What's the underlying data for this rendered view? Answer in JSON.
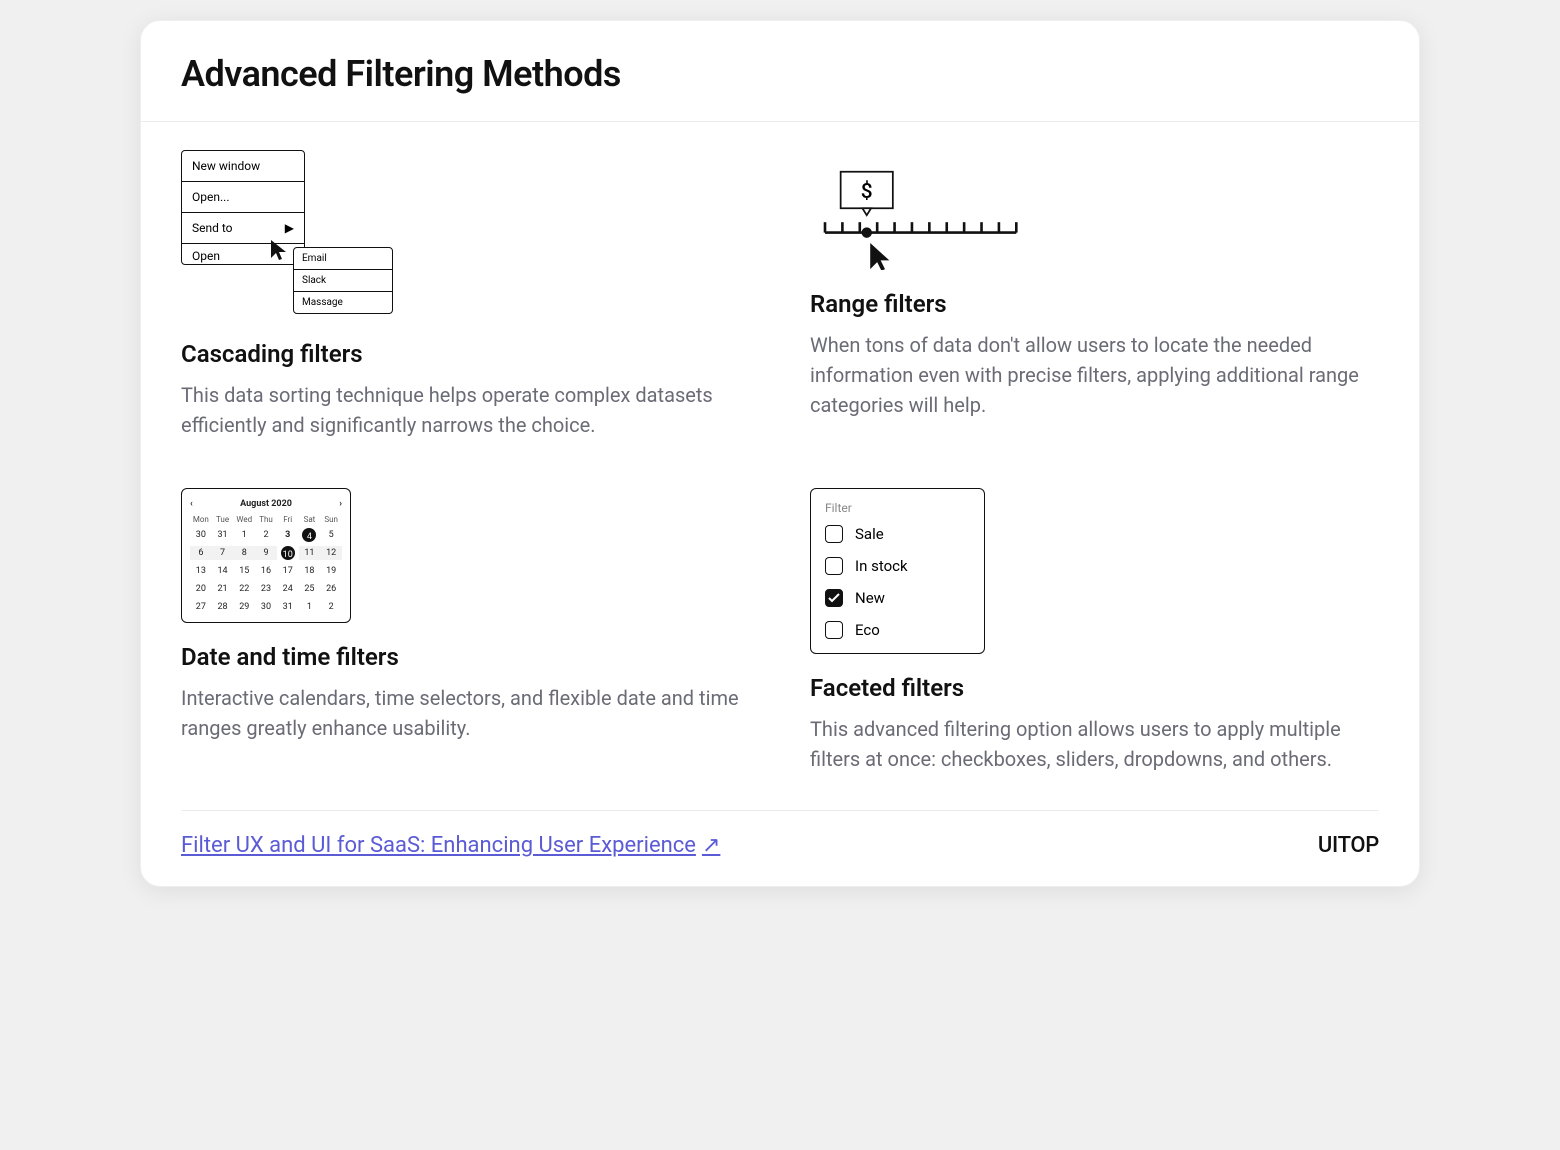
{
  "title": "Advanced Filtering Methods",
  "sections": {
    "cascading": {
      "heading": "Cascading filters",
      "body": "This data sorting technique helps operate complex datasets efficiently and significantly narrows the choice.",
      "menu": {
        "items": [
          "New window",
          "Open...",
          "Send to",
          "Open"
        ],
        "submenu": [
          "Email",
          "Slack",
          "Massage"
        ]
      }
    },
    "range": {
      "heading": "Range filters",
      "body": "When tons of data don't allow users to locate the needed information even with precise filters, applying additional range categories will help.",
      "currency": "$"
    },
    "datetime": {
      "heading": "Date and time filters",
      "body": "Interactive calendars, time selectors, and flexible date and time ranges greatly enhance usability.",
      "calendar": {
        "month": "August 2020",
        "days_of_week": [
          "Mon",
          "Tue",
          "Wed",
          "Thu",
          "Fri",
          "Sat",
          "Sun"
        ],
        "weeks": [
          [
            "30",
            "31",
            "1",
            "2",
            "3",
            "4",
            "5"
          ],
          [
            "6",
            "7",
            "8",
            "9",
            "10",
            "11",
            "12"
          ],
          [
            "13",
            "14",
            "15",
            "16",
            "17",
            "18",
            "19"
          ],
          [
            "20",
            "21",
            "22",
            "23",
            "24",
            "25",
            "26"
          ],
          [
            "27",
            "28",
            "29",
            "30",
            "31",
            "1",
            "2"
          ]
        ],
        "bold_cells": [
          [
            0,
            4
          ]
        ],
        "circle_cells": [
          [
            0,
            5
          ],
          [
            1,
            4
          ]
        ],
        "highlighted_row": 1
      }
    },
    "faceted": {
      "heading": "Faceted filters",
      "body": "This advanced filtering option allows users to apply multiple filters at once: checkboxes, sliders, dropdowns, and others.",
      "label": "Filter",
      "options": [
        {
          "label": "Sale",
          "checked": false
        },
        {
          "label": "In stock",
          "checked": false
        },
        {
          "label": "New",
          "checked": true
        },
        {
          "label": "Eco",
          "checked": false
        }
      ]
    }
  },
  "footer": {
    "link_text": "Filter UX and UI for SaaS: Enhancing User Experience",
    "brand": "UITOP"
  }
}
